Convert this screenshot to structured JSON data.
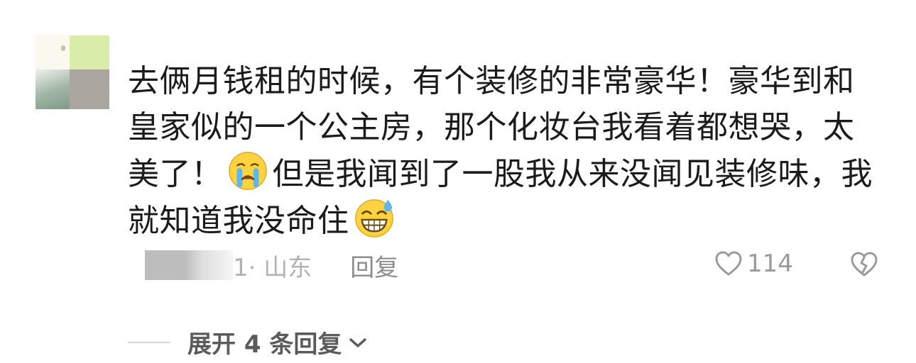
{
  "comment": {
    "text_part1": "去俩月钱租的时候，有个装修的非常豪华！豪华到和皇家似的一个公主房，那个化妆台我看着都想哭，太美了！",
    "emoji1": "crying-emoji",
    "text_part2": "但是我闻到了一股我从来没闻见装修味，我就知道我没命住",
    "emoji2": "grin-sweat-emoji"
  },
  "meta": {
    "location": "1· 山东",
    "reply_label": "回复"
  },
  "actions": {
    "like_count": "114",
    "like_icon": "heart-outline-icon",
    "dislike_icon": "broken-heart-icon"
  },
  "replies": {
    "expand_label": "展开 4 条回复"
  },
  "colors": {
    "text": "#1b1b1b",
    "muted": "#b2b2b2",
    "reply": "#8c8c8c",
    "expand": "#5b5b5b"
  }
}
